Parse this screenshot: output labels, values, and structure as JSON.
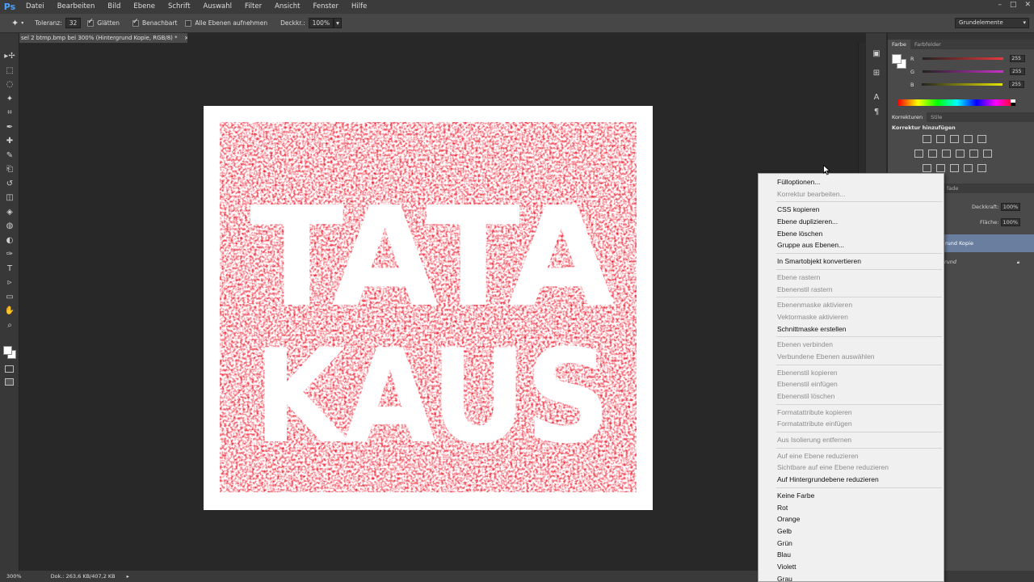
{
  "app": {
    "logo": "Ps",
    "menu": [
      "Datei",
      "Bearbeiten",
      "Bild",
      "Ebene",
      "Schrift",
      "Auswahl",
      "Filter",
      "Ansicht",
      "Fenster",
      "Hilfe"
    ],
    "window_controls": [
      "–",
      "□",
      "✕"
    ]
  },
  "options": {
    "tolerance_label": "Toleranz:",
    "tolerance_value": "32",
    "antialias_label": "Glätten",
    "contiguous_label": "Benachbart",
    "all_layers_label": "Alle Ebenen aufnehmen",
    "opacity_label": "Deckkr.:",
    "opacity_value": "100%",
    "workspace": "Grundelemente"
  },
  "document": {
    "tab_title": "sel 2 btmp.bmp bei 300% (Hintergrund Kopie, RGB/8) *",
    "close": "×",
    "artwork_text_line1": "TATA",
    "artwork_text_line2": "KAUS",
    "artwork_color": "#ee1c2e"
  },
  "color_panel": {
    "tabs": [
      "Farbe",
      "Farbfelder"
    ],
    "channels": [
      {
        "label": "R",
        "value": "255",
        "color": "#e8383c"
      },
      {
        "label": "G",
        "value": "255",
        "color": "#c832c8"
      },
      {
        "label": "B",
        "value": "255",
        "color": "#e6e600"
      }
    ]
  },
  "adjustments_panel": {
    "tabs": [
      "Korrekturen",
      "Stile"
    ],
    "heading": "Korrektur hinzufügen"
  },
  "layers_panel": {
    "tab_partial": "fade",
    "opacity_label": "Deckkraft:",
    "opacity_value": "100%",
    "fill_label": "Fläche:",
    "fill_value": "100%",
    "layers": [
      {
        "name": "rund Kopie",
        "selected": true
      },
      {
        "name": "rund",
        "selected": false
      }
    ]
  },
  "status": {
    "zoom": "300%",
    "doc_info": "Dok.: 263,6 KB/407,2 KB"
  },
  "context_menu": {
    "groups": [
      [
        {
          "label": "Fülloptionen...",
          "enabled": true
        },
        {
          "label": "Korrektur bearbeiten...",
          "enabled": false
        }
      ],
      [
        {
          "label": "CSS kopieren",
          "enabled": true
        },
        {
          "label": "Ebene duplizieren...",
          "enabled": true
        },
        {
          "label": "Ebene löschen",
          "enabled": true
        },
        {
          "label": "Gruppe aus Ebenen...",
          "enabled": true
        }
      ],
      [
        {
          "label": "In Smartobjekt konvertieren",
          "enabled": true
        }
      ],
      [
        {
          "label": "Ebene rastern",
          "enabled": false
        },
        {
          "label": "Ebenenstil rastern",
          "enabled": false
        }
      ],
      [
        {
          "label": "Ebenenmaske aktivieren",
          "enabled": false
        },
        {
          "label": "Vektormaske aktivieren",
          "enabled": false
        },
        {
          "label": "Schnittmaske erstellen",
          "enabled": true
        }
      ],
      [
        {
          "label": "Ebenen verbinden",
          "enabled": false
        },
        {
          "label": "Verbundene Ebenen auswählen",
          "enabled": false
        }
      ],
      [
        {
          "label": "Ebenenstil kopieren",
          "enabled": false
        },
        {
          "label": "Ebenenstil einfügen",
          "enabled": false
        },
        {
          "label": "Ebenenstil löschen",
          "enabled": false
        }
      ],
      [
        {
          "label": "Formatattribute kopieren",
          "enabled": false
        },
        {
          "label": "Formatattribute einfügen",
          "enabled": false
        }
      ],
      [
        {
          "label": "Aus Isolierung entfernen",
          "enabled": false
        }
      ],
      [
        {
          "label": "Auf eine Ebene reduzieren",
          "enabled": false
        },
        {
          "label": "Sichtbare auf eine Ebene reduzieren",
          "enabled": false
        },
        {
          "label": "Auf Hintergrundebene reduzieren",
          "enabled": true
        }
      ],
      [
        {
          "label": "Keine Farbe",
          "enabled": true
        },
        {
          "label": "Rot",
          "enabled": true
        },
        {
          "label": "Orange",
          "enabled": true
        },
        {
          "label": "Gelb",
          "enabled": true
        },
        {
          "label": "Grün",
          "enabled": true
        },
        {
          "label": "Blau",
          "enabled": true
        },
        {
          "label": "Violett",
          "enabled": true
        },
        {
          "label": "Grau",
          "enabled": true
        }
      ]
    ]
  },
  "tool_icons": [
    "move-icon",
    "marquee-icon",
    "lasso-icon",
    "quick-select-icon",
    "crop-icon",
    "eyedropper-icon",
    "healing-icon",
    "brush-icon",
    "clone-stamp-icon",
    "history-brush-icon",
    "eraser-icon",
    "paint-bucket-icon",
    "blur-icon",
    "dodge-icon",
    "pen-icon",
    "type-icon",
    "path-select-icon",
    "shape-icon",
    "hand-icon",
    "zoom-icon"
  ]
}
